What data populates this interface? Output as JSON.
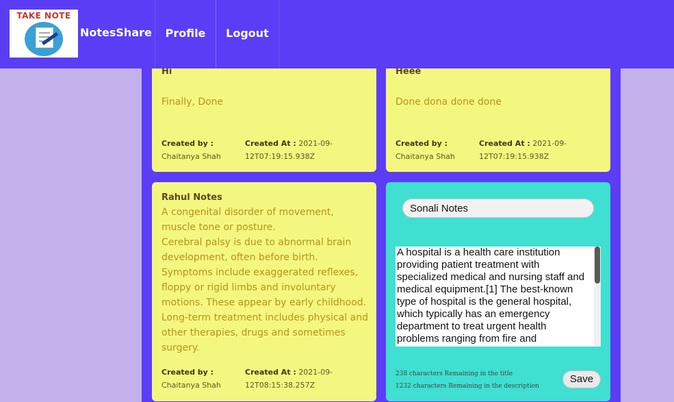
{
  "navbar": {
    "logo_text": "TAKE NOTE",
    "brand": "NotesShare",
    "links": [
      "Profile",
      "Logout"
    ]
  },
  "notes": [
    {
      "title": "Hi",
      "description": "Finally, Done",
      "created_by_label": "Created by :",
      "created_by": "Chaitanya Shah",
      "created_at_label": "Created At :",
      "created_at_1": "2021-09-",
      "created_at_2": "12T07:19:15.938Z"
    },
    {
      "title": "Heee",
      "description": "Done dona done done",
      "created_by_label": "Created by :",
      "created_by": "Chaitanya Shah",
      "created_at_label": "Created At :",
      "created_at_1": "2021-09-",
      "created_at_2": "12T07:19:15.938Z"
    },
    {
      "title": "Rahul Notes",
      "description": "A congenital disorder of movement, muscle tone or posture.\nCerebral palsy is due to abnormal brain development, often before birth.\nSymptoms include exaggerated reflexes, floppy or rigid limbs and involuntary motions. These appear by early childhood.\nLong-term treatment includes physical and other therapies, drugs and sometimes surgery.",
      "created_by_label": "Created by :",
      "created_by": "Chaitanya Shah",
      "created_at_label": "Created At :",
      "created_at_1": "2021-09-",
      "created_at_2": "12T08:15:38.257Z"
    }
  ],
  "editor": {
    "title_value": "Sonali Notes",
    "description_value": "A hospital is a health care institution providing patient treatment with specialized medical and nursing staff and medical equipment.[1] The best-known type of hospital is the general hospital, which typically has an emergency department to treat urgent health problems ranging from fire and",
    "title_remaining": "238 characters Remaining in the title",
    "description_remaining": "1232 characters Remaining in the description",
    "save_label": "Save"
  },
  "colors": {
    "navbar": "#5b3df5",
    "background": "#c4b0ea",
    "note_card": "#f4f77f",
    "edit_card": "#3fdfd1"
  }
}
